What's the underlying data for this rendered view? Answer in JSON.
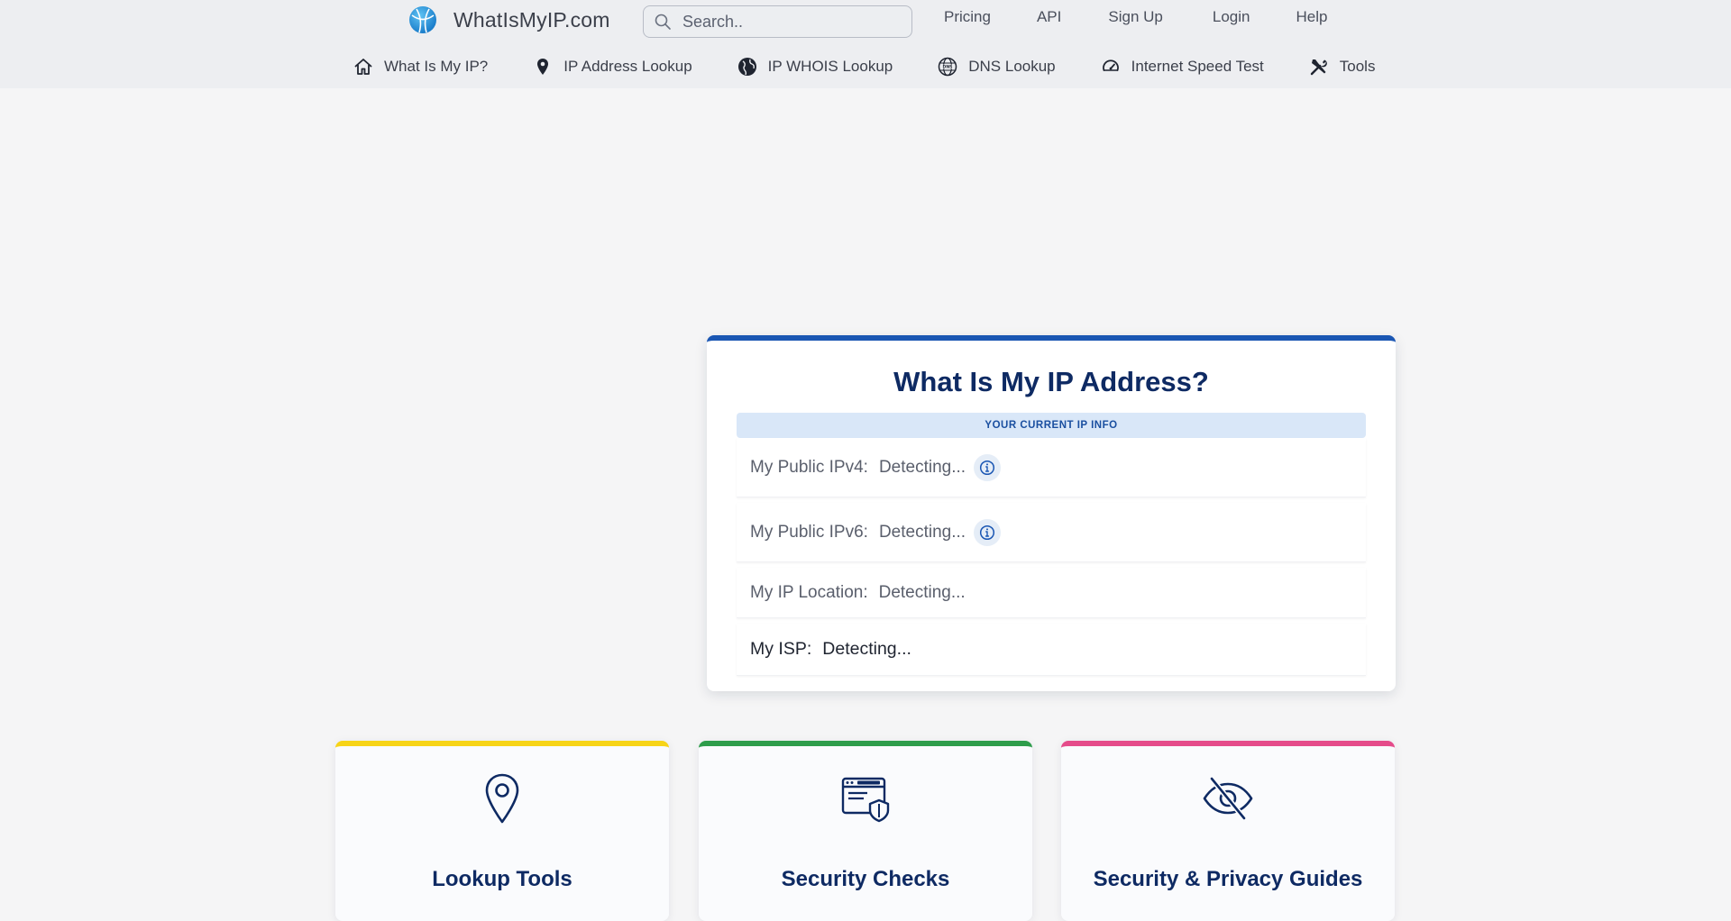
{
  "header": {
    "brand_name": "WhatIsMyIP.com",
    "search": {
      "placeholder": "Search.."
    },
    "top_links": [
      "Pricing",
      "API",
      "Sign Up",
      "Login",
      "Help"
    ],
    "nav": [
      {
        "label": "What Is My IP?",
        "icon": "home-icon"
      },
      {
        "label": "IP Address Lookup",
        "icon": "map-pin-icon"
      },
      {
        "label": "IP WHOIS Lookup",
        "icon": "globe-icon"
      },
      {
        "label": "DNS Lookup",
        "icon": "dns-globe-icon"
      },
      {
        "label": "Internet Speed Test",
        "icon": "speedometer-icon"
      },
      {
        "label": "Tools",
        "icon": "tools-icon"
      }
    ]
  },
  "ip_card": {
    "title": "What Is My IP Address?",
    "section_label": "YOUR CURRENT IP INFO",
    "rows": [
      {
        "label": "My Public IPv4:",
        "value": "Detecting...",
        "info_icon": "info-icon"
      },
      {
        "label": "My Public IPv6:",
        "value": "Detecting...",
        "info_icon": "info-icon"
      },
      {
        "label": "My IP Location:",
        "value": "Detecting..."
      },
      {
        "label": "My ISP:",
        "value": "Detecting..."
      }
    ]
  },
  "features": [
    {
      "title": "Lookup Tools",
      "icon": "location-pin-icon",
      "accent": "#f7d417"
    },
    {
      "title": "Security Checks",
      "icon": "browser-shield-icon",
      "accent": "#2e9d4b"
    },
    {
      "title": "Security & Privacy Guides",
      "icon": "eye-slash-icon",
      "accent": "#e54b8a"
    }
  ],
  "colors": {
    "header_bg": "#edeef1",
    "page_bg": "#f5f5f6",
    "brand_blue": "#1a56b3",
    "title_navy": "#0e2a63",
    "label_bar": "#d9e7f8"
  }
}
